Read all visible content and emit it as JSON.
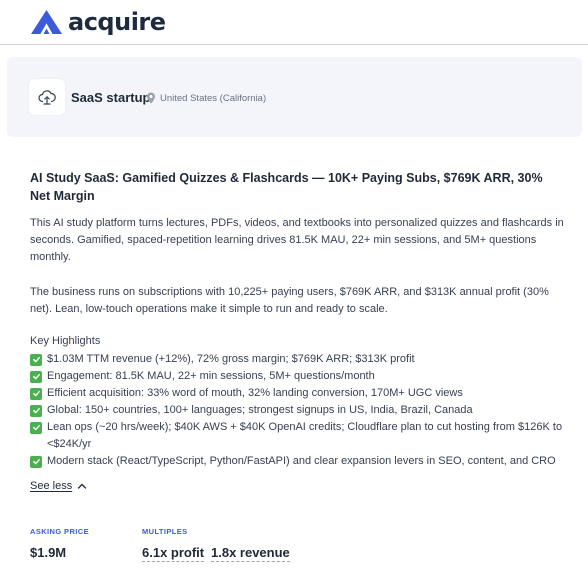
{
  "brand": {
    "name": "acquire",
    "color": "#3b5bdb"
  },
  "company": {
    "name": "SaaS startup",
    "location": "United States (California)",
    "icon": "cloud-upload-icon"
  },
  "listing": {
    "title": "AI Study SaaS: Gamified Quizzes & Flashcards — 10K+ Paying Subs, $769K ARR, 30% Net Margin",
    "paragraphs": [
      "This AI study platform turns lectures, PDFs, videos, and textbooks into personalized quizzes and flashcards in seconds. Gamified, spaced-repetition learning drives 81.5K MAU, 22+ min sessions, and 5M+ questions monthly.",
      "The business runs on subscriptions with 10,225+ paying users, $769K ARR, and $313K annual profit (30% net). Lean, low-touch operations make it simple to run and ready to scale."
    ],
    "highlights_heading": "Key Highlights",
    "highlights": [
      "$1.03M TTM revenue (+12%), 72% gross margin; $769K ARR; $313K profit",
      "Engagement: 81.5K MAU, 22+ min sessions, 5M+ questions/month",
      "Efficient acquisition: 33% word of mouth, 32% landing conversion, 170M+ UGC views",
      "Global: 150+ countries, 100+ languages; strongest signups in US, India, Brazil, Canada",
      "Lean ops (~20 hrs/week); $40K AWS + $40K OpenAI credits; Cloudflare plan to cut hosting from $126K to <$24K/yr",
      "Modern stack (React/TypeScript, Python/FastAPI) and clear expansion levers in SEO, content, and CRO"
    ],
    "see_less": "See less"
  },
  "metrics": {
    "asking_price_label": "ASKING PRICE",
    "asking_price": "$1.9M",
    "multiples_label": "MULTIPLES",
    "profit_multiple": "6.1x profit",
    "revenue_multiple": "1.8x revenue"
  },
  "colors": {
    "check_green": "#4caf50",
    "label_blue": "#3b5bdb",
    "card_bg": "#f3f5fb"
  }
}
